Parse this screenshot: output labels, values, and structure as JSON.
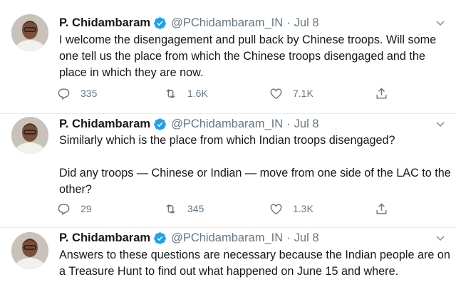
{
  "colors": {
    "accent": "#1da1f2",
    "muted": "#657786",
    "text": "#14171a",
    "divider": "#e6ecf0"
  },
  "tweets": [
    {
      "name": "P. Chidambaram",
      "handle": "@PChidambaram_IN",
      "separator": "·",
      "time": "Jul 8",
      "lines": [
        "I welcome the disengagement and pull back by Chinese troops. Will some",
        "one tell us the place from which the Chinese troops disengaged and the",
        "place in which they are now."
      ],
      "replies": "335",
      "retweets": "1.6K",
      "likes": "7.1K"
    },
    {
      "name": "P. Chidambaram",
      "handle": "@PChidambaram_IN",
      "separator": "·",
      "time": "Jul 8",
      "lines": [
        "Similarly which is the place from which Indian troops disengaged?",
        "",
        "Did any troops — Chinese or Indian — move from one side of the LAC to the",
        "other?"
      ],
      "replies": "29",
      "retweets": "345",
      "likes": "1.3K"
    },
    {
      "name": "P. Chidambaram",
      "handle": "@PChidambaram_IN",
      "separator": "·",
      "time": "Jul 8",
      "lines": [
        "Answers to these questions are necessary because the Indian people are on",
        "a Treasure Hunt to find out what happened on June 15 and where."
      ]
    }
  ],
  "icons": {
    "verified": "verified-badge-icon",
    "caret": "chevron-down-icon",
    "reply": "reply-icon",
    "retweet": "retweet-icon",
    "like": "heart-icon",
    "share": "share-icon"
  }
}
